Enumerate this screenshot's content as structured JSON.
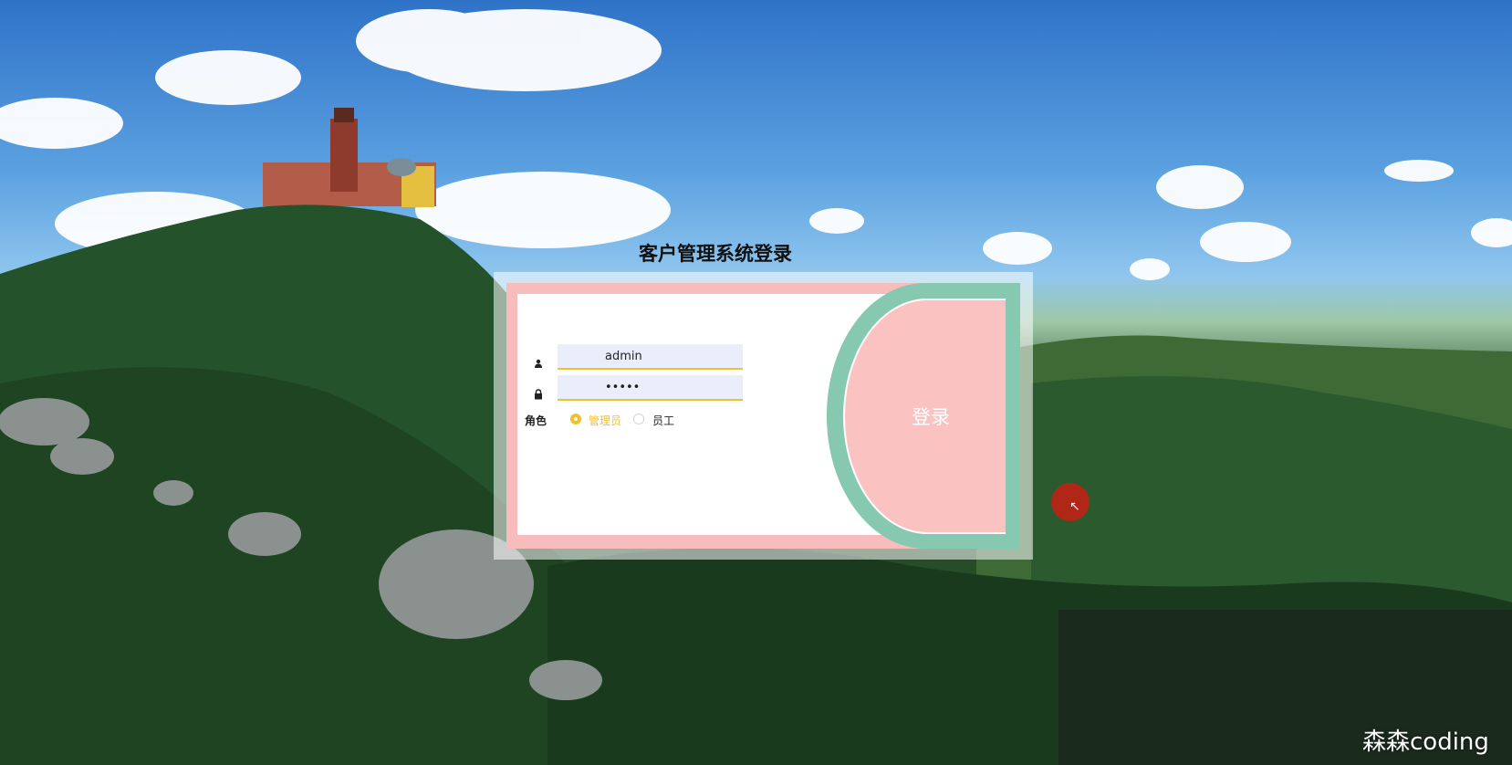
{
  "page": {
    "title": "客户管理系统登录"
  },
  "login_form": {
    "username_value": "admin",
    "password_value": "•••••",
    "role_label": "角色",
    "roles": [
      {
        "label": "管理员",
        "selected": true
      },
      {
        "label": "员工",
        "selected": false
      }
    ],
    "submit_label": "登录"
  },
  "icons": {
    "user": "user-icon",
    "lock": "lock-icon"
  },
  "colors": {
    "accent_yellow": "#f2c028",
    "pink": "#f7bcbc",
    "green": "#87c9b0",
    "button_pink": "#fbc2c2"
  },
  "watermark": "森森coding"
}
